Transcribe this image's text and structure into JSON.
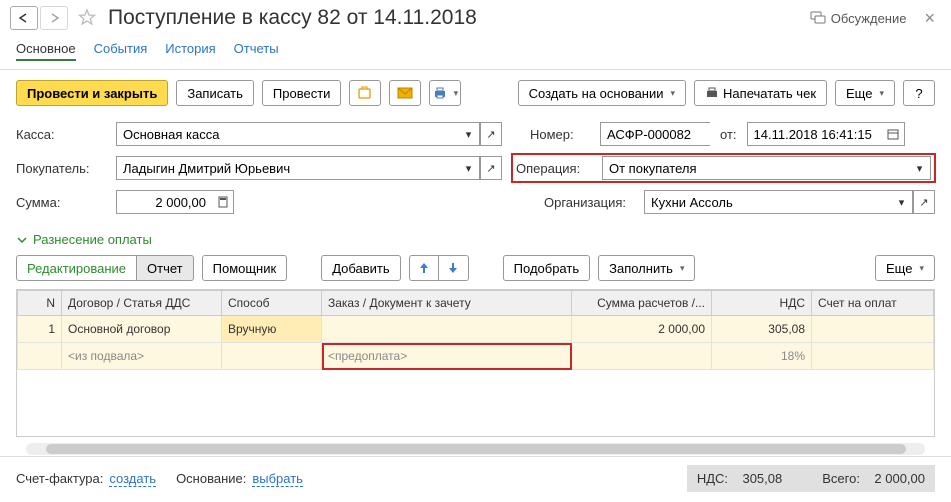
{
  "title": "Поступление в кассу 82 от 14.11.2018",
  "titlebar": {
    "discuss": "Обсуждение"
  },
  "tabs": {
    "t1": "Основное",
    "t2": "События",
    "t3": "История",
    "t4": "Отчеты"
  },
  "toolbar": {
    "post_close": "Провести и закрыть",
    "save": "Записать",
    "post": "Провести",
    "create_from": "Создать на основании",
    "print_receipt": "Напечатать чек",
    "more": "Еще",
    "help": "?"
  },
  "fields": {
    "kassa_lbl": "Касса:",
    "kassa_val": "Основная касса",
    "number_lbl": "Номер:",
    "number_val": "АСФР-000082",
    "from_lbl": "от:",
    "date_val": "14.11.2018 16:41:15",
    "buyer_lbl": "Покупатель:",
    "buyer_val": "Ладыгин Дмитрий Юрьевич",
    "op_lbl": "Операция:",
    "op_val": "От покупателя",
    "sum_lbl": "Сумма:",
    "sum_val": "2 000,00",
    "org_lbl": "Организация:",
    "org_val": "Кухни Ассоль"
  },
  "section": "Разнесение оплаты",
  "subtoolbar": {
    "edit": "Редактирование",
    "report": "Отчет",
    "helper": "Помощник",
    "add": "Добавить",
    "select": "Подобрать",
    "fill": "Заполнить",
    "more": "Еще"
  },
  "table": {
    "h_n": "N",
    "h_contract": "Договор / Статья ДДС",
    "h_method": "Способ",
    "h_order": "Заказ / Документ к зачету",
    "h_sum": "Сумма расчетов /...",
    "h_vat": "НДС",
    "h_invoice": "Счет на оплат",
    "r1_n": "1",
    "r1_contract": "Основной договор",
    "r1_method": "Вручную",
    "r1_sum": "2 000,00",
    "r1_vat": "305,08",
    "r2_contract": "<из подвала>",
    "r2_order": "<предоплата>",
    "r2_vat": "18%"
  },
  "footer": {
    "sf_lbl": "Счет-фактура:",
    "sf_link": "создать",
    "base_lbl": "Основание:",
    "base_link": "выбрать",
    "vat_lbl": "НДС:",
    "vat_val": "305,08",
    "total_lbl": "Всего:",
    "total_val": "2 000,00"
  }
}
